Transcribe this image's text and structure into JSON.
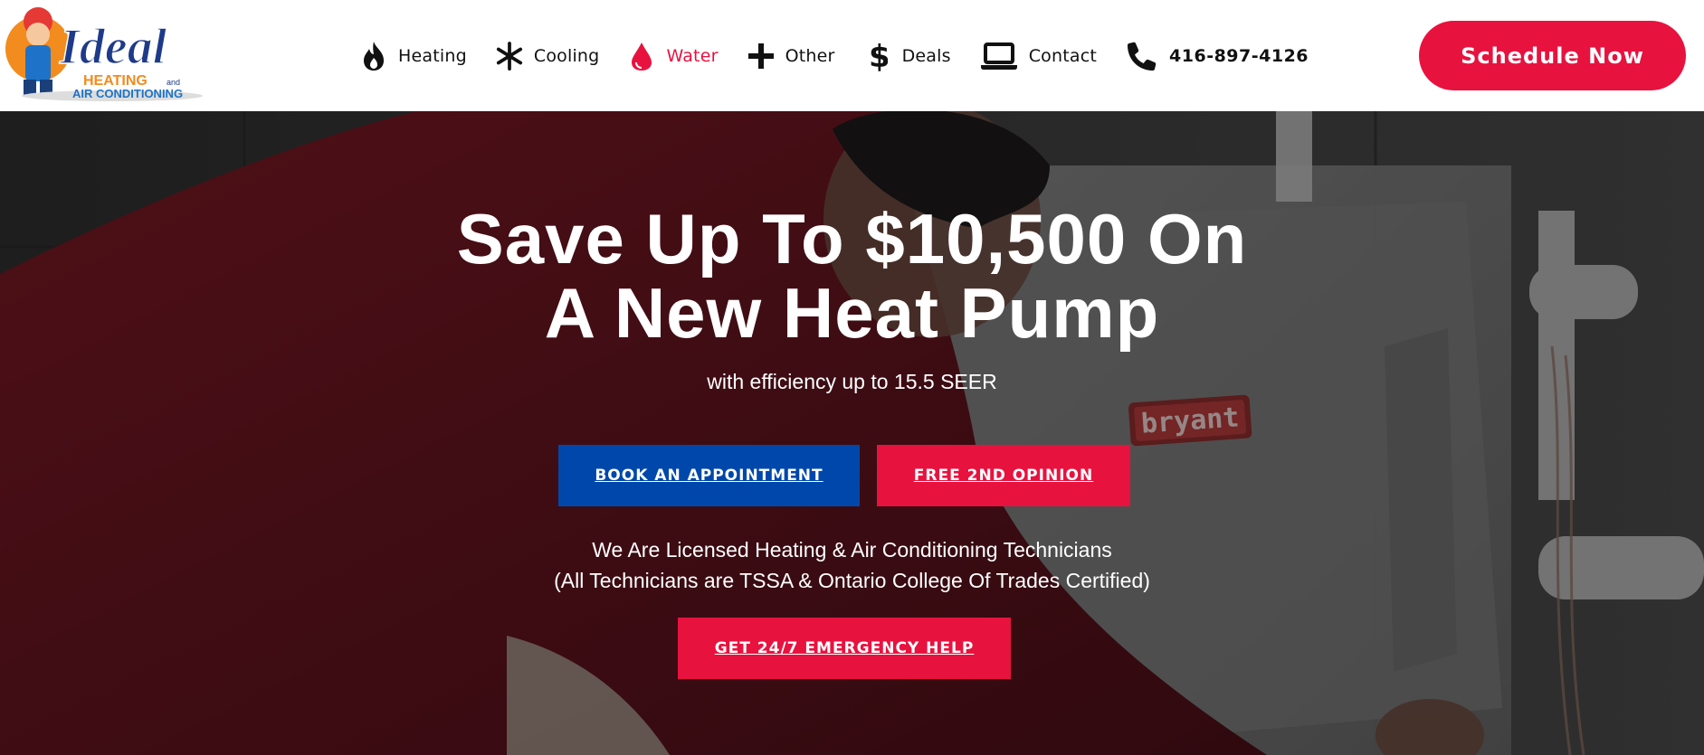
{
  "brand": {
    "logo_text": "Ideal",
    "logo_sub1": "HEATING",
    "logo_and": "and",
    "logo_sub2": "AIR CONDITIONING"
  },
  "nav": {
    "items": [
      {
        "label": "Heating",
        "icon": "flame-icon"
      },
      {
        "label": "Cooling",
        "icon": "snowflake-icon"
      },
      {
        "label": "Water",
        "icon": "water-drop-icon"
      },
      {
        "label": "Other",
        "icon": "plus-icon"
      },
      {
        "label": "Deals",
        "icon": "dollar-icon"
      },
      {
        "label": "Contact",
        "icon": "laptop-icon"
      },
      {
        "label": "416-897-4126",
        "icon": "phone-icon"
      }
    ],
    "schedule_label": "Schedule Now"
  },
  "hero": {
    "title_line1": "Save Up To $10,500 On",
    "title_line2": "A New Heat Pump",
    "subtitle": "with efficiency up to 15.5 SEER",
    "book_label": "BOOK AN APPOINTMENT",
    "opinion_label": "FREE 2ND OPINION",
    "licensed_line1": "We Are Licensed Heating & Air Conditioning Technicians",
    "licensed_line2": "(All Technicians are TSSA & Ontario College Of Trades Certified)",
    "emergency_label": "GET 24/7 EMERGENCY HELP",
    "unit_brand": "bryant"
  },
  "colors": {
    "accent_red": "#e8123f",
    "accent_blue": "#0047ab",
    "active_nav": "#e8123f"
  }
}
